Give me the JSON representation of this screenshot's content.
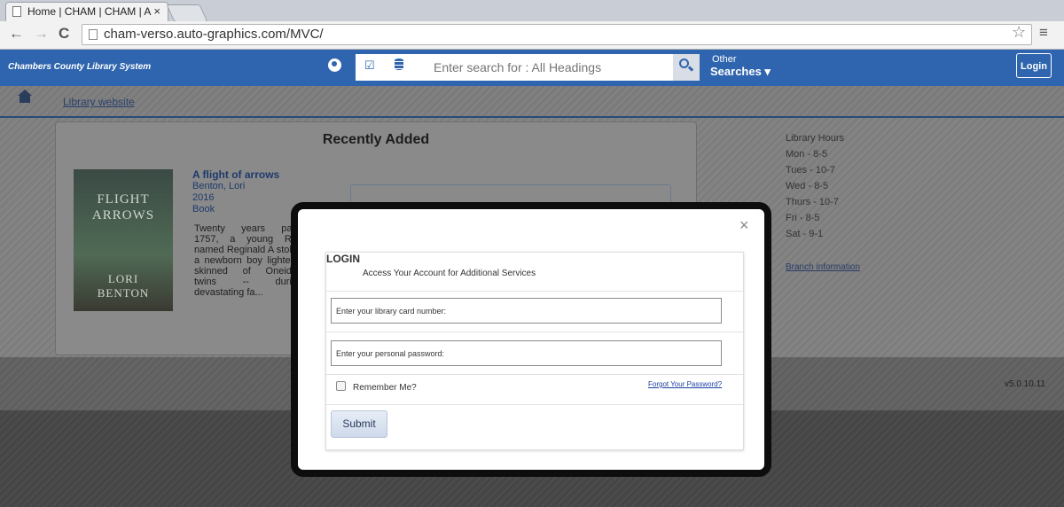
{
  "browser": {
    "tab_title": "Home | CHAM | CHAM | A",
    "tab_close": "×",
    "url": "cham-verso.auto-graphics.com/MVC/",
    "back": "←",
    "forward": "→",
    "reload": "C",
    "star": "☆",
    "menu": "≡"
  },
  "header": {
    "brand": "Chambers County Library System",
    "search_placeholder": "Enter search for : All Headings",
    "other_label": "Other",
    "searches_label": "Searches ▾",
    "login_label": "Login"
  },
  "breadcrumb": {
    "library_website": "Library website"
  },
  "recent": {
    "title": "Recently Added",
    "book": {
      "cover_line1": "FLIGHT",
      "cover_line2": "ARROWS",
      "cover_author1": "LORI",
      "cover_author2": "BENTON",
      "title": "A flight of arrows",
      "author": "Benton, Lori",
      "year": "2016",
      "format": "Book",
      "description": "Twenty years pas 1757, a young Re named Reginald A stole a newborn boy lighter-skinned of Oneida twins -- durin devastating fa..."
    }
  },
  "sidebar": {
    "hours": [
      "Library Hours",
      "Mon - 8-5",
      "Tues - 10-7",
      "Wed - 8-5",
      "Thurs - 10-7",
      "Fri - 8-5",
      "Sat - 9-1"
    ],
    "branch_link": "Branch information"
  },
  "footer": {
    "version": "v5.0.10.11"
  },
  "modal": {
    "close": "×",
    "heading": "LOGIN",
    "subheading": "Access Your Account for Additional Services",
    "card_placeholder": "Enter your library card number:",
    "password_placeholder": "Enter your personal password:",
    "remember_label": "Remember Me?",
    "forgot_link": "Forgot Your Password?",
    "submit_label": "Submit"
  }
}
